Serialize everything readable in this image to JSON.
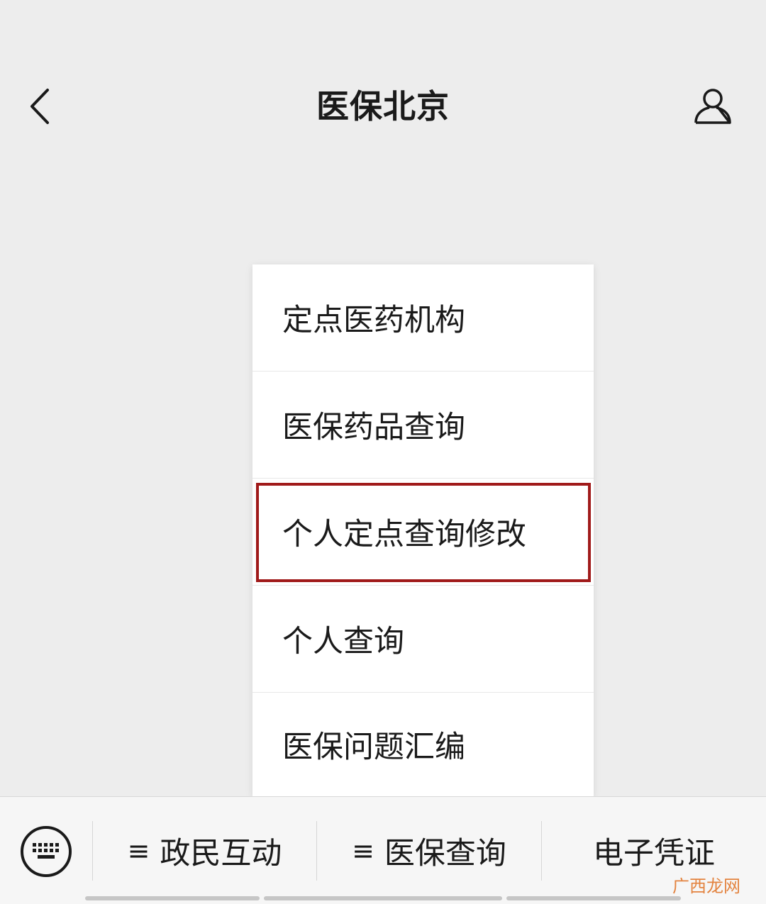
{
  "header": {
    "title": "医保北京",
    "back_icon": "chevron-left-icon",
    "profile_icon": "user-icon"
  },
  "menu": {
    "items": [
      {
        "label": "定点医药机构"
      },
      {
        "label": "医保药品查询"
      },
      {
        "label": "个人定点查询修改",
        "highlighted": true
      },
      {
        "label": "个人查询"
      },
      {
        "label": "医保问题汇编"
      }
    ],
    "highlight_color": "#a01a1a"
  },
  "bottom_bar": {
    "keyboard_icon": "keyboard-icon",
    "menu_glyph": "≡",
    "tabs": [
      {
        "label": "政民互动",
        "has_menu": true
      },
      {
        "label": "医保查询",
        "has_menu": true
      },
      {
        "label": "电子凭证",
        "has_menu": false
      }
    ]
  },
  "watermark": "广西龙网"
}
